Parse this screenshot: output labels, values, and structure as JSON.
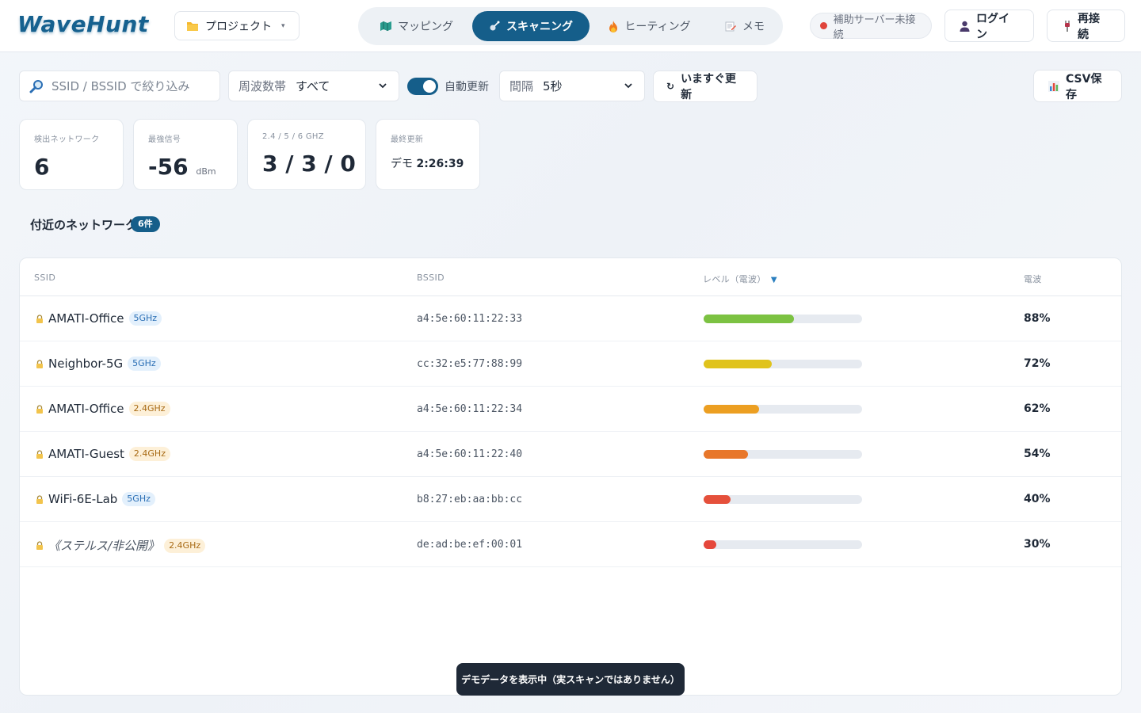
{
  "app": {
    "logo": "WaveHunt"
  },
  "header": {
    "project_label": "プロジェクト",
    "tabs": [
      {
        "label": "マッピング",
        "icon": "map-icon",
        "active": false
      },
      {
        "label": "スキャニング",
        "icon": "satellite-icon",
        "active": true
      },
      {
        "label": "ヒーティング",
        "icon": "fire-icon",
        "active": false
      },
      {
        "label": "メモ",
        "icon": "memo-icon",
        "active": false
      }
    ],
    "server_status": "補助サーバー未接続",
    "login_label": "ログイン",
    "reconnect_label": "再接続"
  },
  "toolbar": {
    "search_placeholder": "SSID / BSSID で絞り込み",
    "band_label": "周波数帯",
    "band_value": "すべて",
    "auto_refresh_label": "自動更新",
    "auto_refresh_on": true,
    "interval_label": "間隔",
    "interval_value": "5秒",
    "refresh_now_label": "いますぐ更新",
    "csv_label": "CSV保存"
  },
  "stats": {
    "detected_label": "検出ネットワーク",
    "detected_value": "6",
    "strongest_label": "最強信号",
    "strongest_value": "-56",
    "strongest_unit": "dBm",
    "bands_label": "2.4 / 5 / 6 GHZ",
    "bands_value": "3 / 3 / 0",
    "updated_label": "最終更新",
    "updated_prefix": "デモ",
    "updated_time": "2:26:39"
  },
  "section": {
    "title": "付近のネットワーク",
    "count_badge": "6件"
  },
  "table": {
    "columns": {
      "ssid": "SSID",
      "bssid": "BSSID",
      "level": "レベル（電波）",
      "pct": "電波"
    },
    "rows": [
      {
        "ssid": "AMATI-Office",
        "band": "5GHz",
        "bssid": "a4:5e:60:11:22:33",
        "level": 0.88,
        "pct": "88%",
        "color": "#7cc242",
        "stealth": false
      },
      {
        "ssid": "Neighbor-5G",
        "band": "5GHz",
        "bssid": "cc:32:e5:77:88:99",
        "level": 0.72,
        "pct": "72%",
        "color": "#e0c31c",
        "stealth": false
      },
      {
        "ssid": "AMATI-Office",
        "band": "2.4GHz",
        "bssid": "a4:5e:60:11:22:34",
        "level": 0.62,
        "pct": "62%",
        "color": "#ec9f22",
        "stealth": false
      },
      {
        "ssid": "AMATI-Guest",
        "band": "2.4GHz",
        "bssid": "a4:5e:60:11:22:40",
        "level": 0.54,
        "pct": "54%",
        "color": "#e8772a",
        "stealth": false
      },
      {
        "ssid": "WiFi-6E-Lab",
        "band": "5GHz",
        "bssid": "b8:27:eb:aa:bb:cc",
        "level": 0.4,
        "pct": "40%",
        "color": "#e5503b",
        "stealth": false
      },
      {
        "ssid": "《ステルス/非公開》",
        "band": "2.4GHz",
        "bssid": "de:ad:be:ef:00:01",
        "level": 0.3,
        "pct": "30%",
        "color": "#e5473b",
        "stealth": true
      }
    ]
  },
  "toast": "デモデータを表示中（実スキャンではありません）"
}
